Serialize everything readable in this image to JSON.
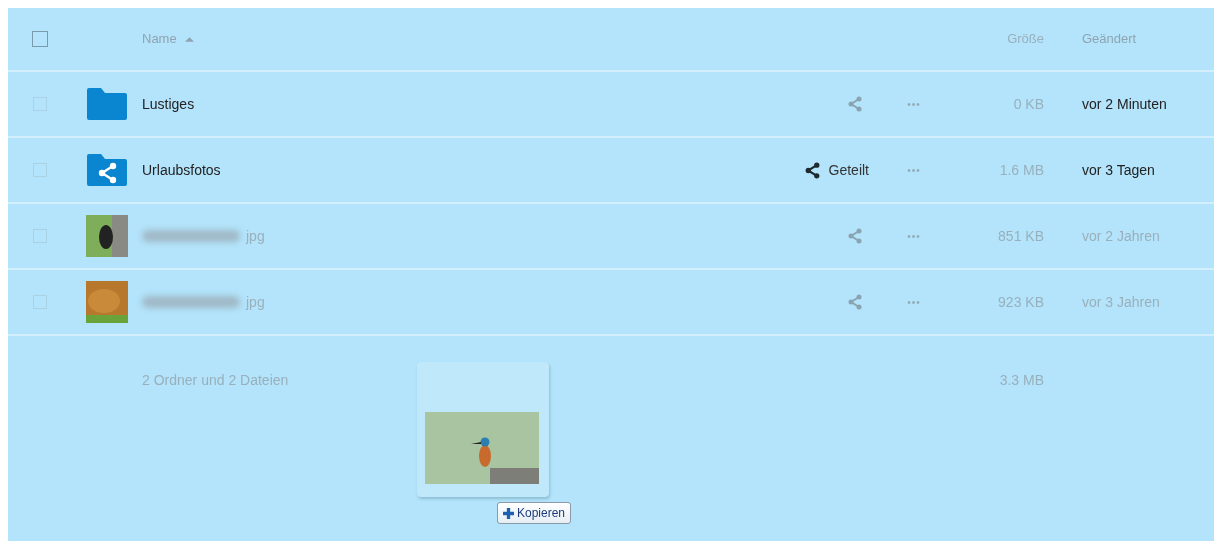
{
  "header": {
    "select_all_checked": false,
    "columns": [
      {
        "label": "Name",
        "sorted": true
      },
      {
        "label": "Größe",
        "sorted": false
      },
      {
        "label": "Geändert",
        "sorted": false
      }
    ]
  },
  "files": [
    {
      "kind": "folder",
      "name": "Lustiges",
      "name_blurred": false,
      "muted": false,
      "checked": false,
      "menu": "•••",
      "size": "0 KB",
      "modified": "vor 2 Minuten"
    },
    {
      "kind": "shared-folder",
      "name": "Urlaubsfotos",
      "name_blurred": false,
      "muted": false,
      "checked": false,
      "share_label": "Geteilt",
      "menu": "•••",
      "size": "1.6 MB",
      "modified": "vor 3 Tagen"
    },
    {
      "kind": "image",
      "name": "jpg",
      "name_blurred": true,
      "muted": true,
      "checked": false,
      "menu": "•••",
      "size": "851 KB",
      "modified": "vor 2 Jahren"
    },
    {
      "kind": "image",
      "name": "jpg",
      "name_blurred": true,
      "muted": true,
      "checked": false,
      "menu": "•••",
      "size": "923 KB",
      "modified": "vor 3 Jahren"
    }
  ],
  "summary": {
    "text": "2 Ordner und 2 Dateien",
    "size": "3.3 MB"
  },
  "drag": {
    "action": "Kopieren"
  }
}
